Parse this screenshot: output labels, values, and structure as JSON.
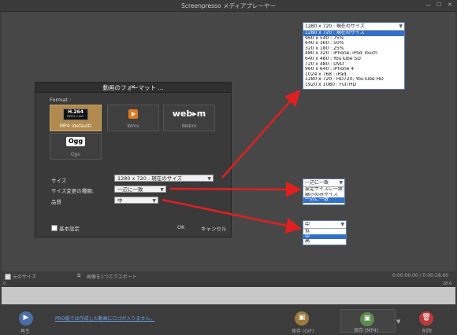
{
  "window": {
    "title": "Screenpresso メディアプレーヤー"
  },
  "dialog": {
    "title": "動画のフォーマット ...",
    "format_label": "Format :",
    "formats": [
      {
        "label": "MP4 (default)",
        "logo": "H.264",
        "logo_sub": "MPEG-4 AVC",
        "selected": true
      },
      {
        "label": "Wmv",
        "logo": "",
        "logo_sub": "",
        "selected": false
      },
      {
        "label": "Webm",
        "logo": "web▸m",
        "logo_sub": "",
        "selected": false
      },
      {
        "label": "Ogv",
        "logo": "Ogg",
        "logo_sub": "",
        "selected": false
      }
    ],
    "size_label": "サイズ",
    "size_value": "1280 x 720 : 現在のサイズ",
    "resize_label": "サイズ変更の種類:",
    "resize_value": "一辺に一致",
    "quality_label": "品質",
    "quality_value": "中",
    "basic_settings_label": "基本設定",
    "ok_label": "OK",
    "cancel_label": "キャンセル"
  },
  "size_popup": {
    "head": "1280 x 720 : 現在のサイズ",
    "options": [
      "1280 x 720 : 現在のサイズ",
      "960 x 540 : 75%",
      "640 x 360 : 50%",
      "320 x 180 : 25%",
      "480 x 320 : iPhone, iPod Touch",
      "640 x 480 : YouTube SD",
      "720 x 480 : DVD",
      "960 x 640 : iPhone 4",
      "1024 x 768 : iPad",
      "1280 x 720 : HD720, YouTube HD",
      "1920 x 1080 : Full HD"
    ],
    "highlighted": 0
  },
  "resize_popup": {
    "head": "一辺に一致",
    "options": [
      "設定サイズに一致",
      "縮小のみサイズ",
      "一辺に一致"
    ],
    "highlighted": 2
  },
  "quality_popup": {
    "head": "中",
    "options": [
      "低",
      "中",
      "高"
    ],
    "highlighted": 1
  },
  "player": {
    "actual_size_label": "元のサイズ",
    "export_frame_label": "画像を1つエクスポート",
    "timecode": "0:00:00.00 / 0:00:28.60",
    "timeline_start": "0",
    "timeline_end": "28.6",
    "play_label": "再生",
    "promo_text": "PRO版では作成した動画にロゴが入りません。",
    "save_gif_label": "保存 (GIF)",
    "save_mp4_label": "保存 (MP4)",
    "delete_label": "削除"
  },
  "colors": {
    "accent_red": "#e02020",
    "selection_blue": "#3370c8"
  }
}
